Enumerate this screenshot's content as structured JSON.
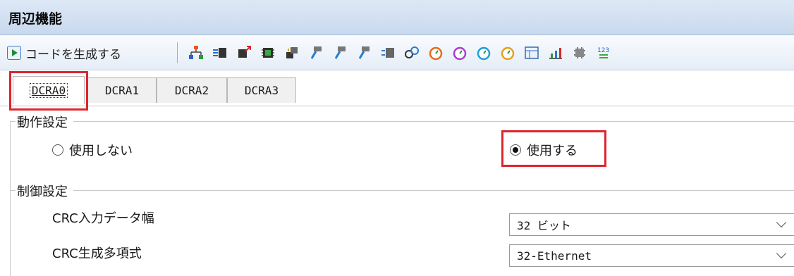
{
  "window": {
    "title": "周辺機能"
  },
  "toolbar": {
    "generate_label": "コードを生成する",
    "icons": [
      "org-chart-icon",
      "clock-chip-icon",
      "chip-arrow-icon",
      "chip-green-icon",
      "chip-stack-icon",
      "connector-icon",
      "connector-icon",
      "connector-icon",
      "grid-chip-icon",
      "link-icon",
      "timer-icon",
      "timer-icon",
      "timer-icon",
      "timer-icon",
      "panel-icon",
      "chart-icon",
      "chip-gray-icon",
      "numbers-icon"
    ]
  },
  "tabs": [
    {
      "label": "DCRA0",
      "active": true
    },
    {
      "label": "DCRA1",
      "active": false
    },
    {
      "label": "DCRA2",
      "active": false
    },
    {
      "label": "DCRA3",
      "active": false
    }
  ],
  "operation": {
    "title": "動作設定",
    "option_off": "使用しない",
    "option_on": "使用する",
    "selected": "使用する"
  },
  "control": {
    "title": "制御設定",
    "width_label": "CRC入力データ幅",
    "width_value": "32 ビット",
    "poly_label": "CRC生成多項式",
    "poly_value": "32-Ethernet"
  },
  "colors": {
    "highlight": "#e0242e",
    "titlebar": "#c8d9ee"
  }
}
